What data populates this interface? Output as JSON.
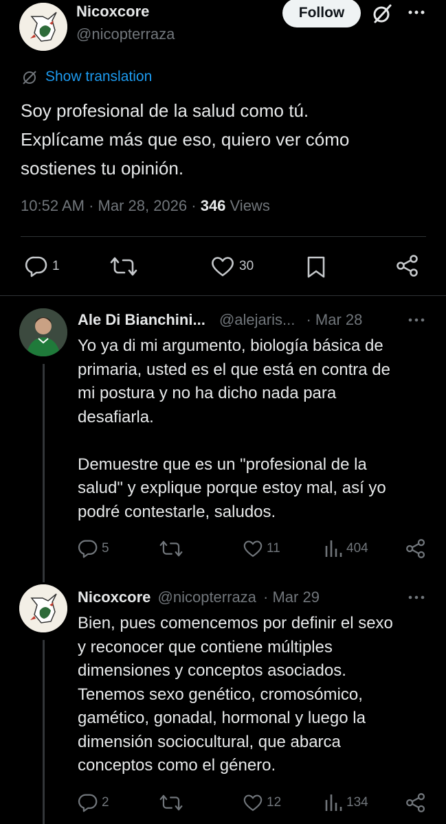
{
  "main_tweet": {
    "author_name": "Nicoxcore",
    "author_handle": "@nicopterraza",
    "follow_label": "Follow",
    "show_translation": "Show translation",
    "text_lines": [
      "Soy profesional de la salud como tú.",
      "Explícame más que eso, quiero ver cómo",
      "sostienes tu opinión."
    ],
    "time_date": "10:52 AM · Mar 28, 2026 · ",
    "views_count": "346",
    "views_label": " Views",
    "replies": "1",
    "likes": "30"
  },
  "replies": [
    {
      "author_name": "Ale Di Bianchini...",
      "author_handle": "@alejaris...",
      "date": "· Mar 28",
      "text": "Yo ya di mi argumento, biología básica de\nprimaria, usted es el que está en contra de\nmi postura y no ha dicho nada para\ndesafiarla.\n\nDemuestre que es un \"profesional de la\nsalud\" y explique porque estoy mal, así yo\npodré contestarle, saludos.",
      "replies": "5",
      "likes": "11",
      "views": "404"
    },
    {
      "author_name": "Nicoxcore",
      "author_handle": "@nicopterraza",
      "date": "· Mar 29",
      "text": "Bien, pues comencemos por definir el sexo\ny reconocer que contiene múltiples\ndimensiones y conceptos asociados.\nTenemos sexo genético, cromosómico,\ngamético, gonadal, hormonal y luego la\ndimensión sociocultural, que abarca\nconceptos como el género.",
      "replies": "2",
      "likes": "12",
      "views": "134"
    }
  ],
  "colors": {
    "background": "#000000",
    "text": "#e7e9ea",
    "secondary": "#71767b",
    "link": "#1d9bf0",
    "divider": "#2f3336"
  }
}
